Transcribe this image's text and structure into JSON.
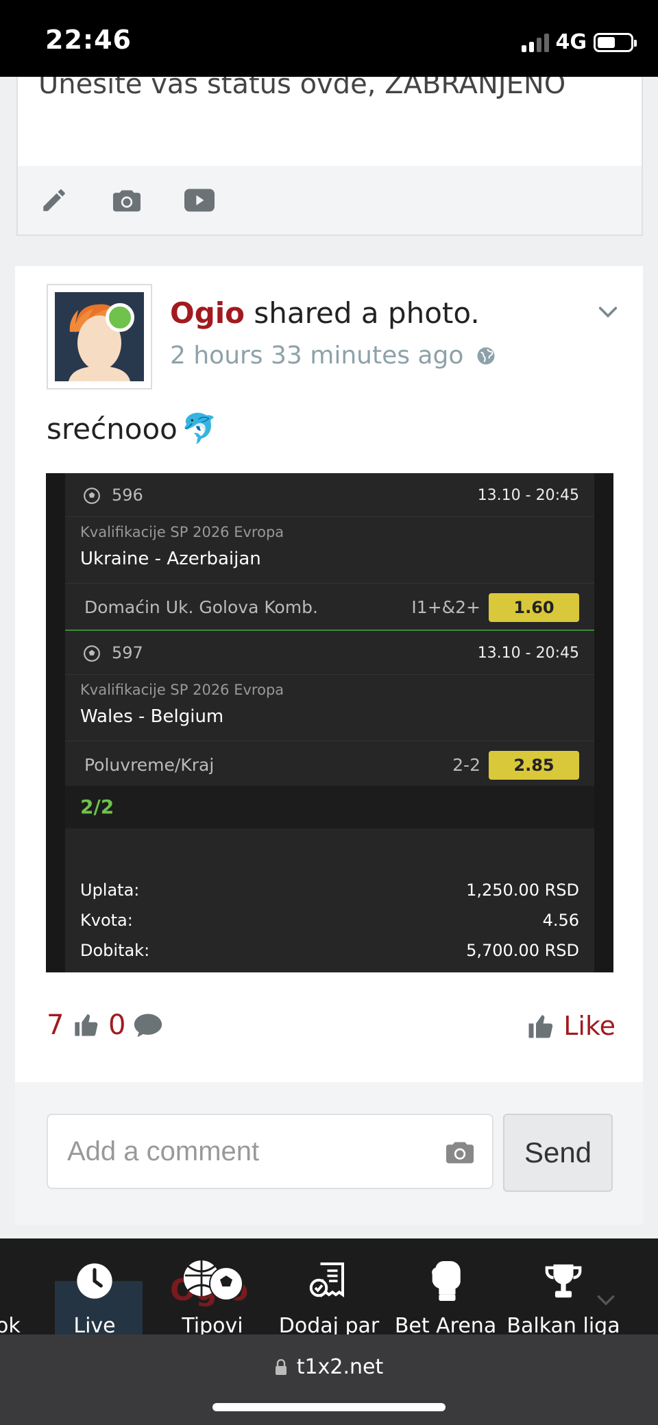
{
  "status_bar": {
    "time": "22:46",
    "network": "4G"
  },
  "status_card": {
    "text": "Unesite vas status ovde, ZABRANJENO"
  },
  "post": {
    "author": "Ogio",
    "action": "shared a photo.",
    "time": "2 hours 33 minutes ago",
    "caption": "srećnooo",
    "caption_emoji": "🐬",
    "bet_slip": {
      "matches": [
        {
          "id": "596",
          "date": "13.10  -  20:45",
          "league": "Kvalifikacije SP 2026 Evropa",
          "teams": "Ukraine - Azerbaijan",
          "pick": "Domaćin Uk. Golova Komb.",
          "code": "I1+&2+",
          "odd": "1.60"
        },
        {
          "id": "597",
          "date": "13.10  -  20:45",
          "league": "Kvalifikacije SP 2026 Evropa",
          "teams": "Wales - Belgium",
          "pick": "Poluvreme/Kraj",
          "code": "2-2",
          "odd": "2.85"
        }
      ],
      "combo": "2/2",
      "summary": [
        {
          "label": "Uplata:",
          "value": "1,250.00 RSD"
        },
        {
          "label": "Kvota:",
          "value": "4.56"
        },
        {
          "label": "Dobitak:",
          "value": "5,700.00 RSD"
        }
      ]
    },
    "likes_count": "7",
    "comments_count": "0",
    "like_label": "Like"
  },
  "comment": {
    "placeholder": "Add a comment",
    "send_label": "Send"
  },
  "bottom_nav": {
    "partial_left": "ok",
    "ghost_name": "Ogio",
    "items": [
      {
        "label": "Live"
      },
      {
        "label": "Tipovi"
      },
      {
        "label": "Dodaj par"
      },
      {
        "label": "Bet Arena"
      },
      {
        "label": "Balkan liga"
      }
    ]
  },
  "url_bar": {
    "url": "t1x2.net"
  },
  "colors": {
    "brand_red": "#a11a1f",
    "online_green": "#6fc24b",
    "odd_yellow": "#d9c83a"
  }
}
